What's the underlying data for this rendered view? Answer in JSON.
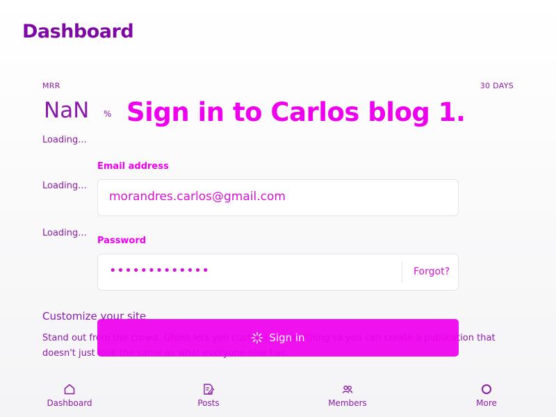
{
  "header": {
    "title": "Dashboard"
  },
  "stats": {
    "mrr_label": "MRR",
    "range_label": "30 DAYS",
    "value": "NaN",
    "unit": "%",
    "loading": [
      "Loading...",
      "Loading...",
      "Loading..."
    ]
  },
  "signin": {
    "title": "Sign in to Carlos blog 1.",
    "email_label": "Email address",
    "email_value": "morandres.carlos@gmail.com",
    "password_label": "Password",
    "password_value": "•••••••••••••",
    "forgot_label": "Forgot?",
    "button_label": "Sign in"
  },
  "customize": {
    "title": "Customize your site",
    "text": "Stand out from the crowd. Ghost lets you customize everything so you can create a publication that doesn't just look the same as what everyone else has."
  },
  "nav": {
    "items": [
      {
        "label": "Dashboard",
        "icon": "home-icon"
      },
      {
        "label": "Posts",
        "icon": "edit-icon"
      },
      {
        "label": "Members",
        "icon": "members-icon"
      },
      {
        "label": "More",
        "icon": "more-icon"
      }
    ]
  },
  "colors": {
    "accent": "#ee00ee",
    "primary_text": "#8a1aa8",
    "title": "#7d0aa3"
  }
}
